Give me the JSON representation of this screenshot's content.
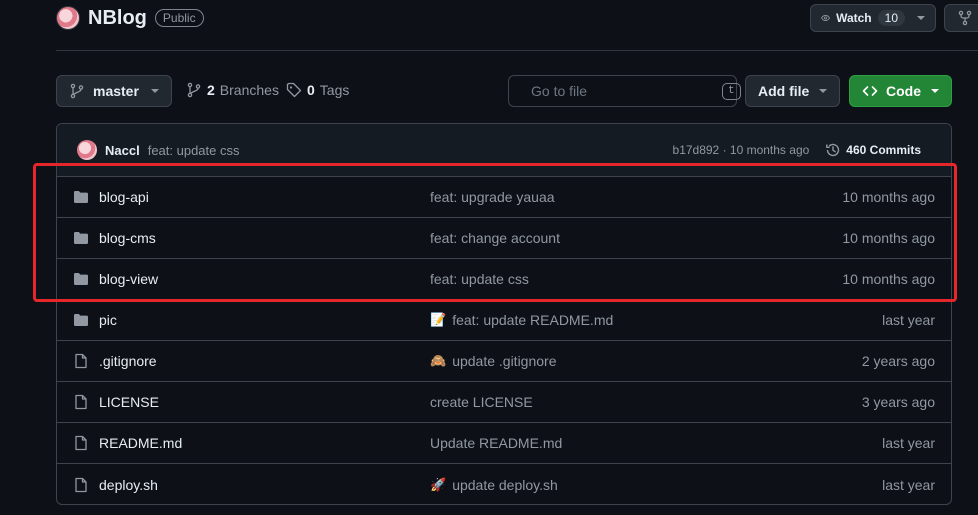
{
  "repo": {
    "name": "NBlog",
    "visibility": "Public"
  },
  "watch": {
    "label": "Watch",
    "count": "10"
  },
  "toolbar": {
    "branch": "master",
    "branches_count": "2",
    "branches_label": "Branches",
    "tags_count": "0",
    "tags_label": "Tags",
    "search_placeholder": "Go to file",
    "search_shortcut": "t",
    "add_file_label": "Add file",
    "code_label": "Code"
  },
  "latest_commit": {
    "author": "Naccl",
    "message": "feat: update css",
    "hash_time": "b17d892 · 10 months ago",
    "commits_label": "460 Commits"
  },
  "files": [
    {
      "type": "folder",
      "name": "blog-api",
      "emoji": "",
      "message": "feat: upgrade yauaa",
      "time": "10 months ago"
    },
    {
      "type": "folder",
      "name": "blog-cms",
      "emoji": "",
      "message": "feat: change account",
      "time": "10 months ago"
    },
    {
      "type": "folder",
      "name": "blog-view",
      "emoji": "",
      "message": "feat: update css",
      "time": "10 months ago"
    },
    {
      "type": "folder",
      "name": "pic",
      "emoji": "📝",
      "message": "feat: update README.md",
      "time": "last year"
    },
    {
      "type": "file",
      "name": ".gitignore",
      "emoji": "🙈",
      "message": "update .gitignore",
      "time": "2 years ago"
    },
    {
      "type": "file",
      "name": "LICENSE",
      "emoji": "",
      "message": "create LICENSE",
      "time": "3 years ago"
    },
    {
      "type": "file",
      "name": "README.md",
      "emoji": "",
      "message": "Update README.md",
      "time": "last year"
    },
    {
      "type": "file",
      "name": "deploy.sh",
      "emoji": "🚀",
      "message": "update deploy.sh",
      "time": "last year"
    }
  ],
  "colors": {
    "background": "#0d1117",
    "code_button": "#238636",
    "highlight_box": "#e5272c",
    "folder_icon": "#9198a1"
  }
}
